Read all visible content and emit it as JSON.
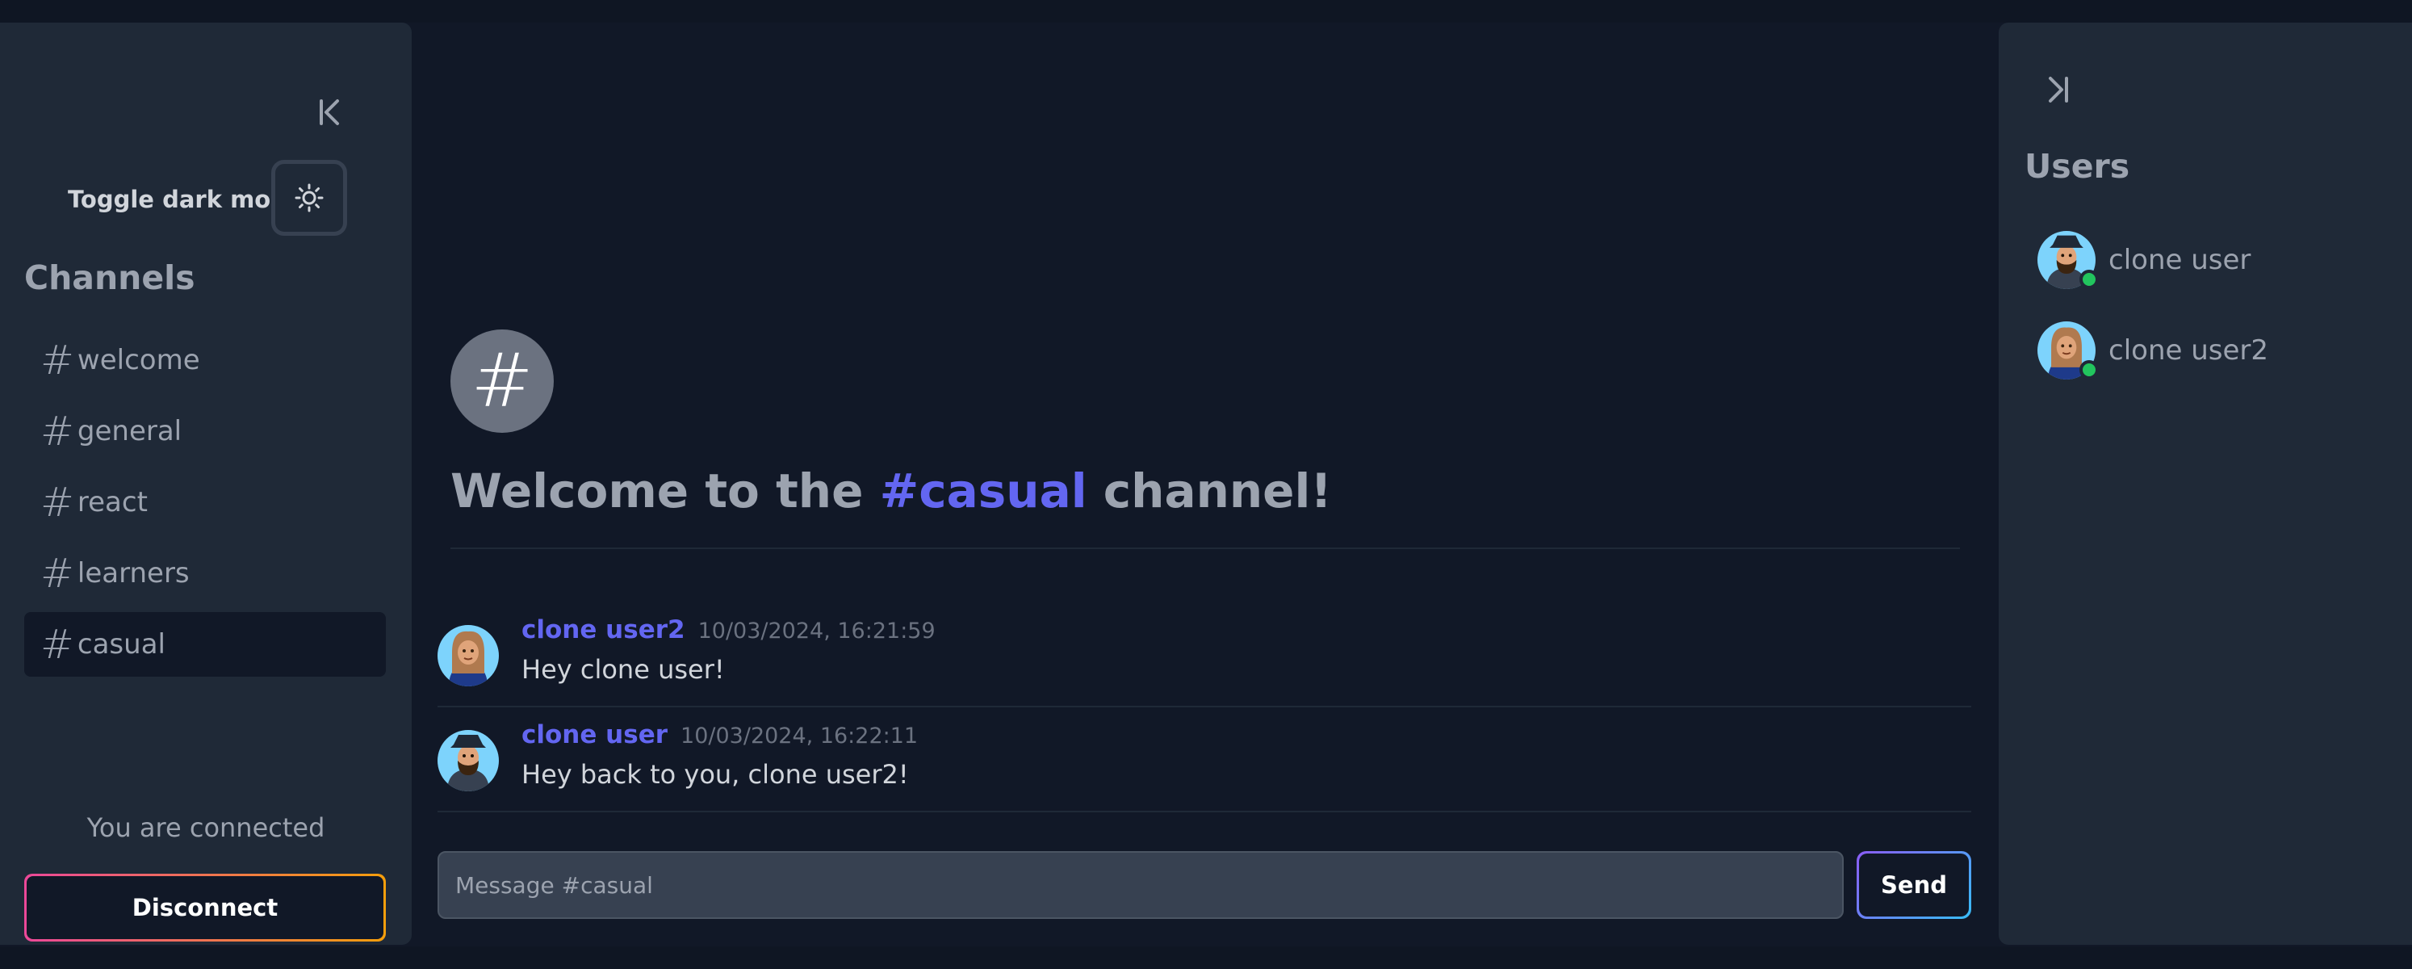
{
  "left_sidebar": {
    "collapse_icon": "collapse-left-icon",
    "dark_mode_label": "Toggle dark mode",
    "dark_mode_icon": "sun-icon",
    "channels_title": "Channels",
    "channels": [
      {
        "name": "welcome",
        "active": false
      },
      {
        "name": "general",
        "active": false
      },
      {
        "name": "react",
        "active": false
      },
      {
        "name": "learners",
        "active": false
      },
      {
        "name": "casual",
        "active": true
      }
    ],
    "status_text": "You are connected",
    "disconnect_label": "Disconnect"
  },
  "main": {
    "channel_symbol": "#",
    "welcome_prefix": "Welcome to the ",
    "welcome_channel": "#casual",
    "welcome_suffix": " channel!",
    "messages": [
      {
        "author": "clone user2",
        "timestamp": "10/03/2024, 16:21:59",
        "text": "Hey clone user!"
      },
      {
        "author": "clone user",
        "timestamp": "10/03/2024, 16:22:11",
        "text": "Hey back to you, clone user2!"
      }
    ],
    "input_placeholder": "Message #casual",
    "send_label": "Send"
  },
  "right_sidebar": {
    "collapse_icon": "collapse-right-icon",
    "users_title": "Users",
    "users": [
      {
        "name": "clone user",
        "status": "online"
      },
      {
        "name": "clone user2",
        "status": "online"
      }
    ]
  },
  "colors": {
    "background": "#111827",
    "panel": "#1f2937",
    "accent": "#6366f1",
    "online": "#22c55e"
  }
}
